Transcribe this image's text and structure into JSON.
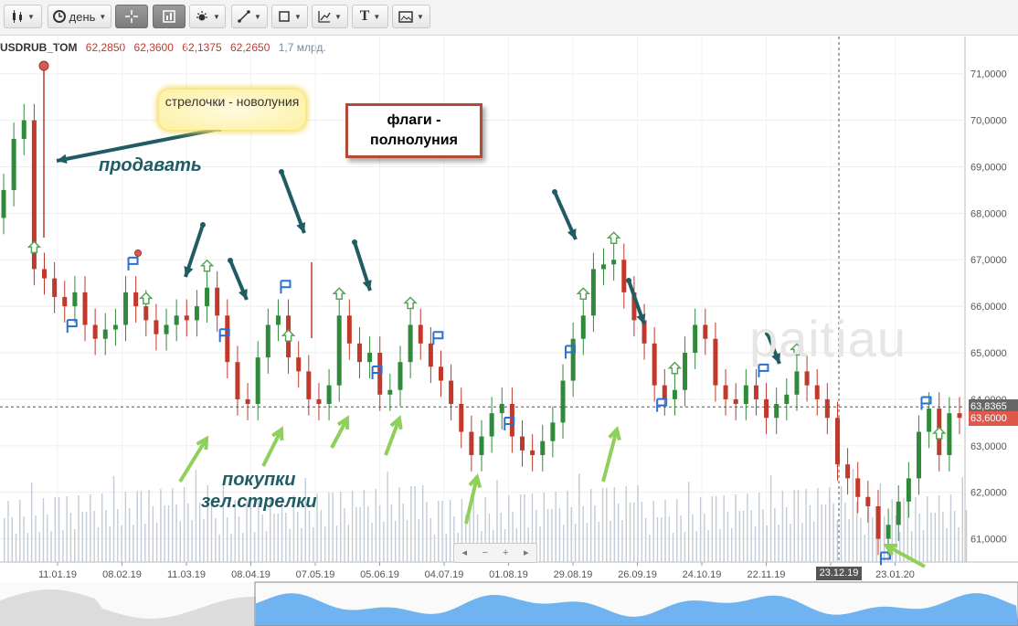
{
  "toolbar": {
    "period_label": "день",
    "buttons": [
      "bar-chart-type",
      "period",
      "crosshair",
      "indicators",
      "settings",
      "line-tool",
      "shapes-tool",
      "fibonacci-tool",
      "text-tool",
      "screenshot"
    ]
  },
  "ticker": {
    "symbol": "USDRUB_TOM",
    "open": "62,2850",
    "high": "62,3600",
    "low": "62,1375",
    "close": "62,2650",
    "volume": "1,7 млрд."
  },
  "annotations": {
    "new_moon_callout": "стрелочки - новолуния",
    "full_moon_callout": "флаги - полнолуния",
    "sell": "продавать",
    "buy_line1": "покупки",
    "buy_line2": "зел.стрелки",
    "watermark": "paitiau"
  },
  "navigator": {
    "prev": "◂",
    "minus": "−",
    "plus": "+",
    "next": "▸"
  },
  "colors": {
    "up": "#2f8a3a",
    "down": "#c0392b",
    "arrow_dark": "#1f5c63",
    "arrow_light": "#8fd05a",
    "flag": "#2a6fd6",
    "volume": "#c3cbd6"
  },
  "chart_data": {
    "type": "candlestick",
    "y_axis_labels": [
      "71,0000",
      "70,0000",
      "69,0000",
      "68,0000",
      "67,0000",
      "66,0000",
      "65,0000",
      "64,0000",
      "63,0000",
      "62,0000",
      "61,0000"
    ],
    "x_axis_labels": [
      "11.01.19",
      "08.02.19",
      "11.03.19",
      "08.04.19",
      "07.05.19",
      "05.06.19",
      "04.07.19",
      "01.08.19",
      "29.08.19",
      "26.09.19",
      "24.10.19",
      "22.11.19",
      "23.12.19",
      "23.01.20"
    ],
    "ylim": [
      60.5,
      71.8
    ],
    "crosshair": {
      "price": "63,8365",
      "date": "23.12.19"
    },
    "last_price": "63,6000",
    "close_series": [
      68.5,
      69.6,
      70.0,
      66.8,
      66.6,
      66.2,
      66.0,
      66.3,
      65.6,
      65.3,
      65.5,
      65.6,
      66.3,
      66.0,
      65.7,
      65.4,
      65.6,
      65.8,
      65.7,
      66.0,
      66.4,
      65.8,
      64.8,
      64.0,
      63.9,
      64.9,
      65.6,
      65.8,
      64.9,
      64.6,
      64.0,
      63.9,
      64.3,
      65.8,
      65.2,
      64.8,
      65.0,
      64.1,
      64.2,
      64.8,
      65.6,
      65.2,
      64.7,
      64.4,
      63.9,
      63.3,
      62.8,
      63.2,
      63.7,
      63.9,
      63.2,
      62.9,
      62.8,
      63.1,
      63.5,
      64.4,
      65.3,
      65.8,
      66.8,
      66.9,
      67.0,
      66.3,
      65.7,
      65.2,
      64.3,
      64.0,
      64.2,
      65.0,
      65.6,
      65.3,
      64.3,
      64.0,
      63.9,
      64.3,
      64.0,
      63.6,
      63.9,
      64.1,
      64.6,
      64.3,
      64.0,
      63.6,
      62.6,
      62.3,
      61.9,
      61.7,
      61.0,
      61.3,
      61.8,
      62.3,
      63.3,
      63.8,
      62.8,
      63.7,
      63.6
    ],
    "new_moon_arrows_dates_index": [
      3,
      14,
      20,
      28,
      33,
      40,
      57,
      60,
      66,
      78,
      92
    ],
    "full_moon_flags_index": [
      6,
      12,
      21,
      27,
      36,
      42,
      49,
      55,
      64,
      74,
      86,
      90,
      95
    ],
    "volume_note": "bars"
  }
}
